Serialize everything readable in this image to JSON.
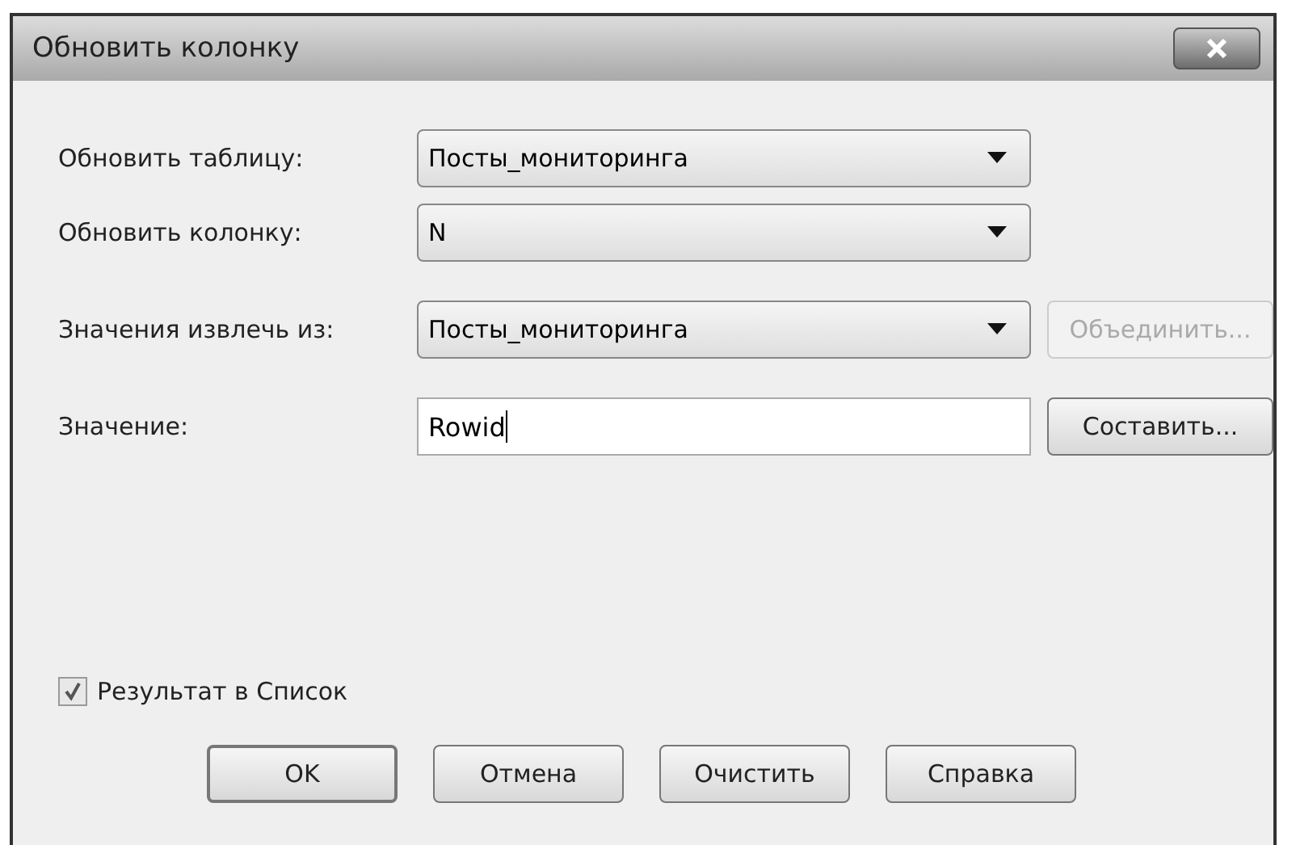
{
  "window": {
    "title": "Обновить колонку"
  },
  "rows": [
    {
      "label": "Обновить таблицу:",
      "kind": "combo",
      "value": "Посты_мониторинга"
    },
    {
      "label": "Обновить колонку:",
      "kind": "combo",
      "value": "N"
    },
    {
      "label": "Значения извлечь из:",
      "kind": "combo",
      "value": "Посты_мониторинга",
      "button": {
        "label": "Объединить...",
        "disabled": true
      }
    },
    {
      "label": "Значение:",
      "kind": "text",
      "value": "Rowid",
      "button": {
        "label": "Составить...",
        "disabled": false
      }
    }
  ],
  "checkbox": {
    "label": "Результат в Список",
    "checked": true
  },
  "buttons": [
    "OK",
    "Отмена",
    "Очистить",
    "Справка"
  ]
}
